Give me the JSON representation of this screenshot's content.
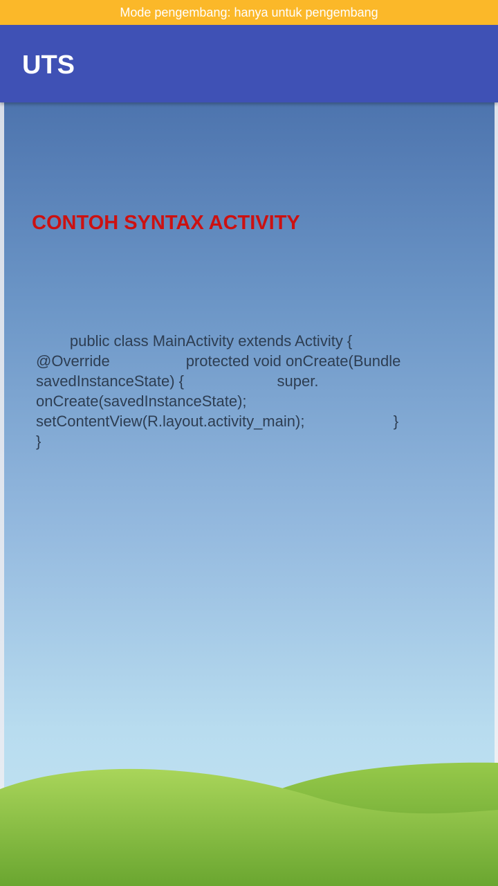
{
  "status_banner": {
    "text": "Mode pengembang: hanya untuk pengembang"
  },
  "app_bar": {
    "title": "UTS"
  },
  "main": {
    "heading": "CONTOH SYNTAX ACTIVITY",
    "code_lines": [
      "        public class MainActivity extends Activity {",
      "@Override                  protected void onCreate(Bundle",
      "savedInstanceState) {                      super.",
      "onCreate(savedInstanceState);",
      "setContentView(R.layout.activity_main);                     }",
      "}"
    ]
  },
  "colors": {
    "banner": "#fbb829",
    "app_bar": "#3f51b5",
    "heading": "#cc1111",
    "code_text": "#2d3d52",
    "sky_top": "#4d74ae",
    "sky_bottom": "#c6e6f4",
    "grass": "#7cb83e"
  }
}
